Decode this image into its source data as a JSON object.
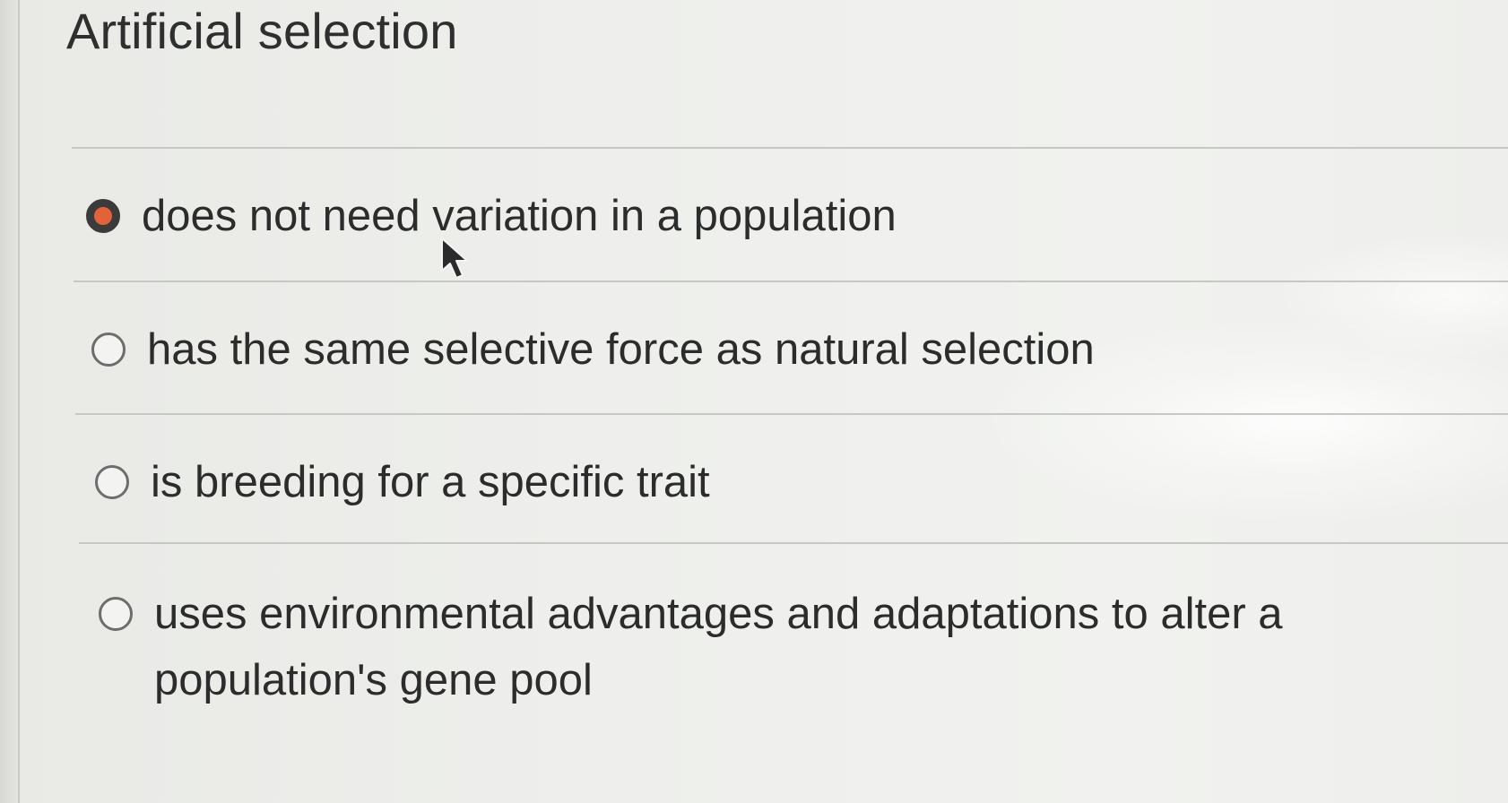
{
  "question": {
    "title": "Artificial selection"
  },
  "answers": [
    {
      "label": "does not need variation in a population",
      "selected": true
    },
    {
      "label": "has the same selective force as natural selection",
      "selected": false
    },
    {
      "label": "is breeding for a specific trait",
      "selected": false
    },
    {
      "label": "uses environmental advantages and adaptations to alter a population's gene pool",
      "selected": false
    }
  ],
  "colors": {
    "selected_radio": "#e2633a",
    "background": "#ecedea"
  },
  "icons": {
    "cursor": "mouse-pointer-icon"
  }
}
